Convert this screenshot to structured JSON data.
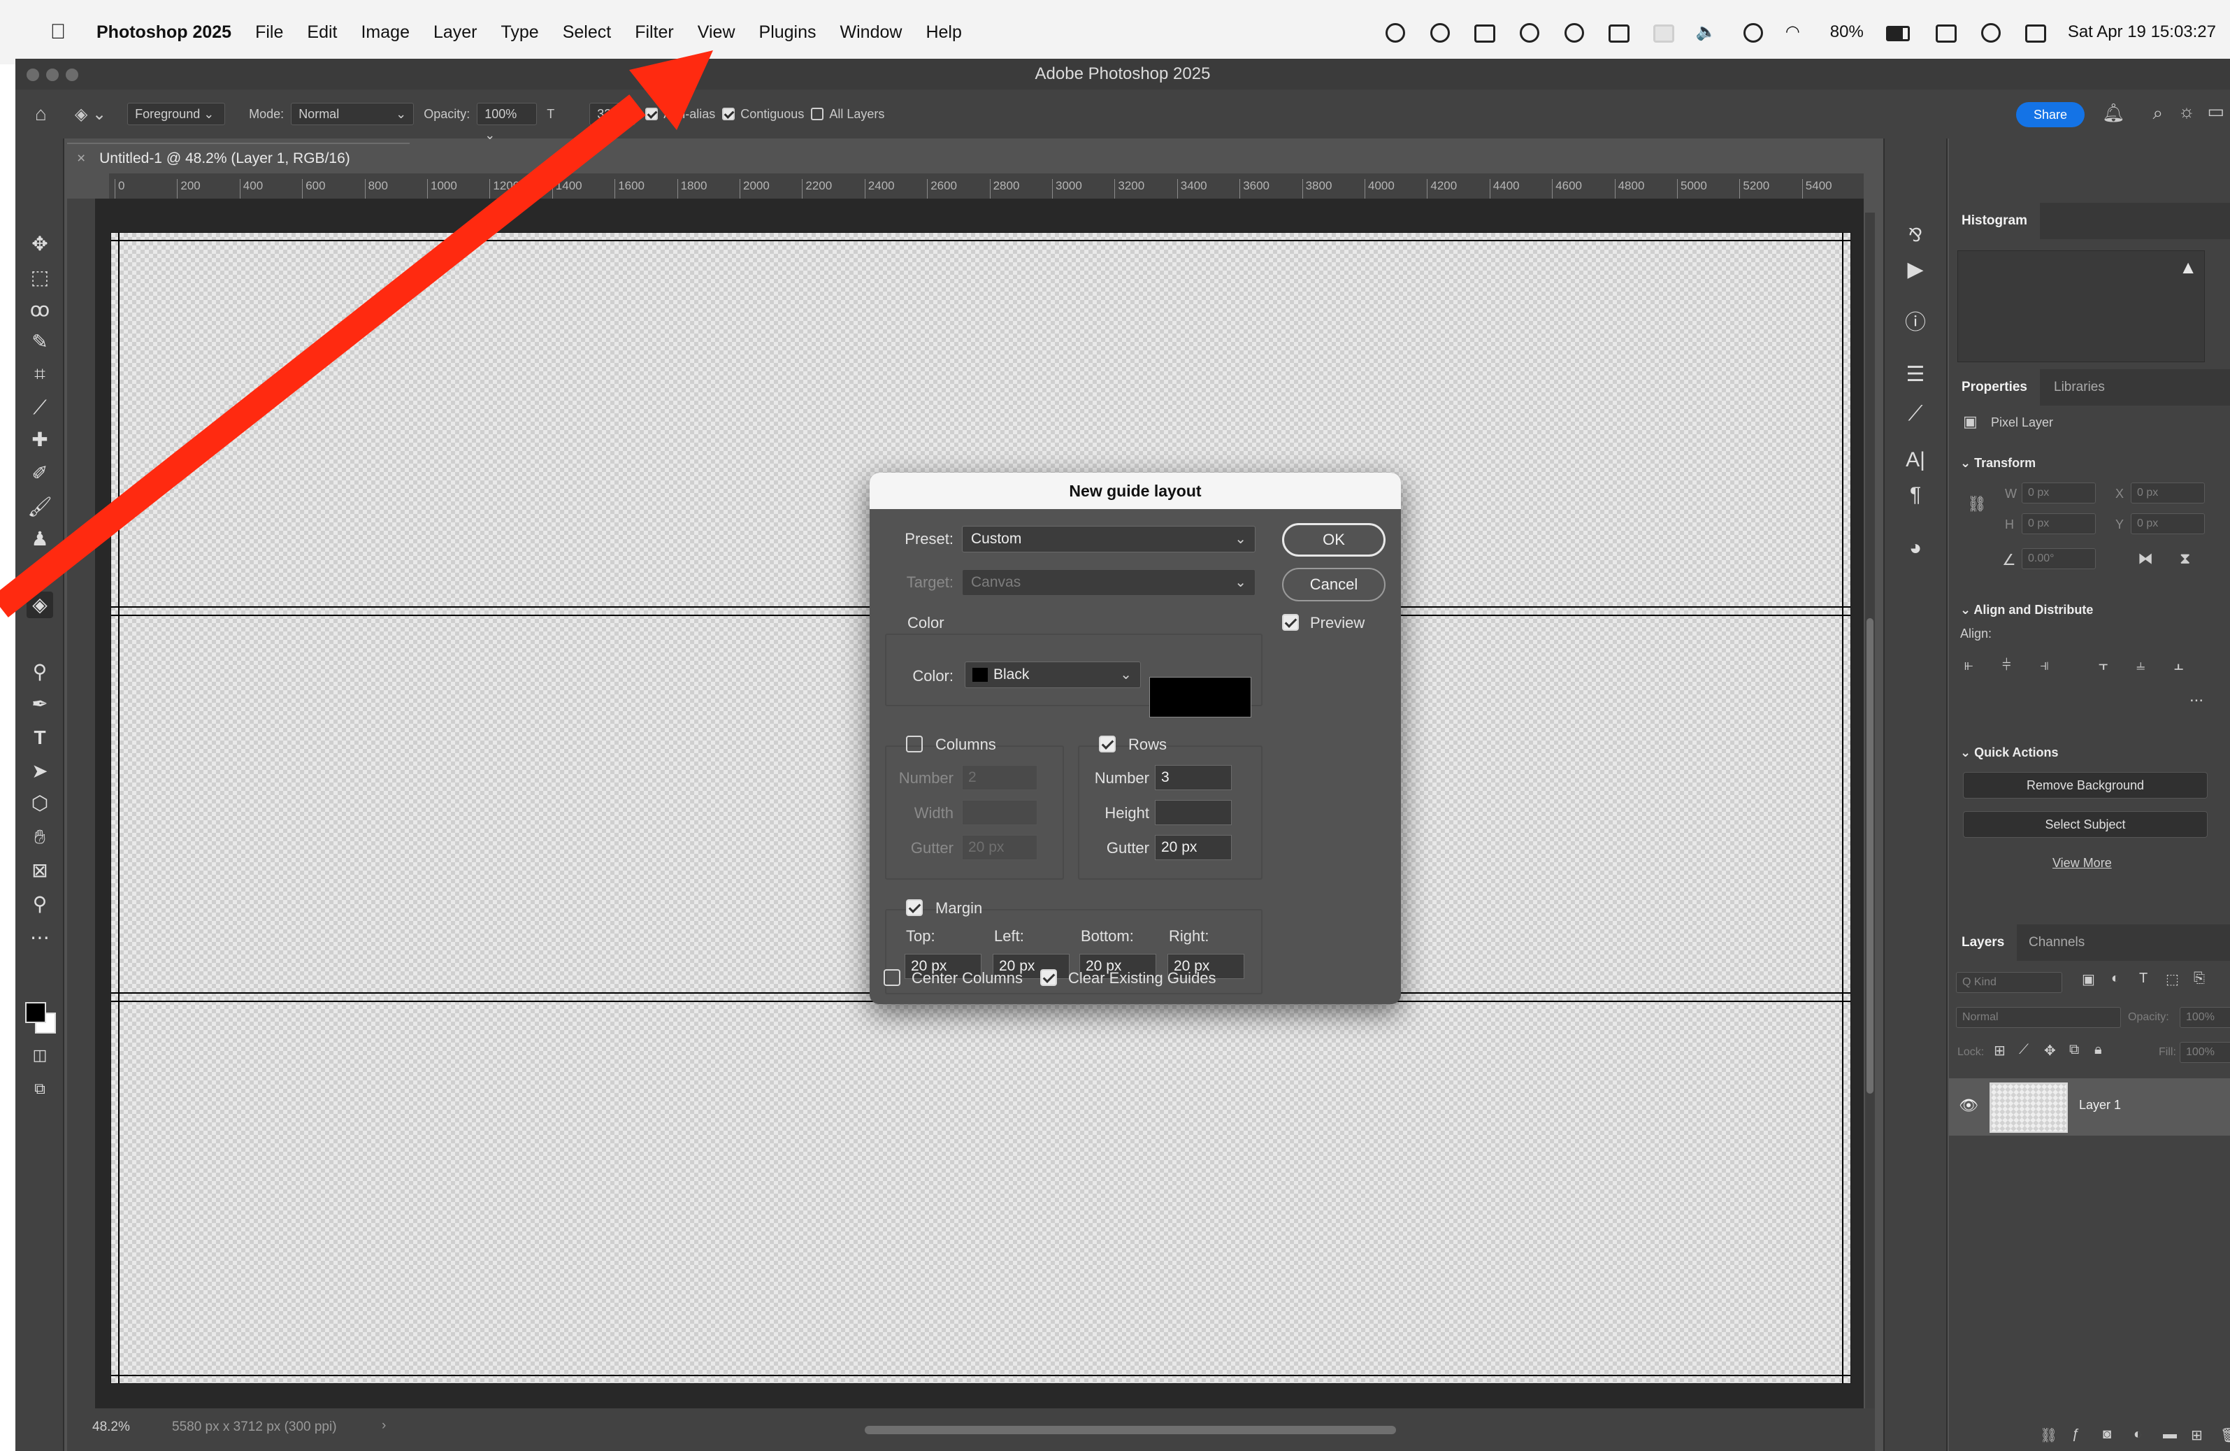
{
  "menubar": {
    "items": [
      "Photoshop 2025",
      "File",
      "Edit",
      "Image",
      "Layer",
      "Type",
      "Select",
      "Filter",
      "View",
      "Plugins",
      "Window",
      "Help"
    ],
    "battery": "80%",
    "datetime": "Sat Apr 19  15:03:27"
  },
  "window": {
    "title": "Adobe Photoshop 2025"
  },
  "options_bar": {
    "fill_source": "Foreground",
    "mode_label": "Mode:",
    "mode_value": "Normal",
    "opacity_label": "Opacity:",
    "opacity_value": "100%",
    "tolerance_label": "T",
    "tolerance_value": "32",
    "anti_alias": "Anti-alias",
    "contiguous": "Contiguous",
    "all_layers": "All Layers",
    "share": "Share"
  },
  "document": {
    "tab_title": "Untitled-1 @ 48.2% (Layer 1, RGB/16)",
    "ruler_marks": [
      "0",
      "200",
      "400",
      "600",
      "800",
      "1000",
      "1200",
      "1400",
      "1600",
      "1800",
      "2000",
      "2200",
      "2400",
      "2600",
      "2800",
      "3000",
      "3200",
      "3400",
      "3600",
      "3800",
      "4000",
      "4200",
      "4400",
      "4600",
      "4800",
      "5000",
      "5200",
      "5400"
    ],
    "zoom": "48.2%",
    "doc_info": "5580 px x 3712 px (300 ppi)"
  },
  "panels": {
    "histogram_tab": "Histogram",
    "properties_tab": "Properties",
    "libraries_tab": "Libraries",
    "pixel_layer": "Pixel Layer",
    "transform": "Transform",
    "w_label": "W",
    "h_label": "H",
    "x_label": "X",
    "y_label": "Y",
    "w_value": "0 px",
    "h_value": "0 px",
    "x_value": "0 px",
    "y_value": "0 px",
    "angle_value": "0.00°",
    "align_distribute": "Align and Distribute",
    "align_label": "Align:",
    "more": "...",
    "quick_actions": "Quick Actions",
    "remove_background": "Remove Background",
    "select_subject": "Select Subject",
    "view_more": "View More",
    "layers_tab": "Layers",
    "channels_tab": "Channels",
    "kind_placeholder": "Q Kind",
    "blend_mode": "Normal",
    "opacity_label": "Opacity:",
    "opacity_value": "100%",
    "lock_label": "Lock:",
    "fill_label": "Fill:",
    "fill_value": "100%",
    "layer_name": "Layer 1"
  },
  "dialog": {
    "title": "New guide layout",
    "preset_label": "Preset:",
    "preset_value": "Custom",
    "target_label": "Target:",
    "target_value": "Canvas",
    "color_section": "Color",
    "color_label": "Color:",
    "color_value": "Black",
    "columns_label": "Columns",
    "rows_label": "Rows",
    "number_label": "Number",
    "width_label": "Width",
    "height_label": "Height",
    "gutter_label": "Gutter",
    "col_number": "2",
    "col_gutter": "20 px",
    "row_number": "3",
    "row_gutter": "20 px",
    "margin_label": "Margin",
    "top_label": "Top:",
    "left_label": "Left:",
    "bottom_label": "Bottom:",
    "right_label": "Right:",
    "margin_top": "20 px",
    "margin_left": "20 px",
    "margin_bottom": "20 px",
    "margin_right": "20 px",
    "center_columns": "Center Columns",
    "clear_guides": "Clear Existing Guides",
    "ok": "OK",
    "cancel": "Cancel",
    "preview": "Preview"
  },
  "colors": {
    "accent": "#1473e6",
    "arrow": "#ff2a10"
  }
}
